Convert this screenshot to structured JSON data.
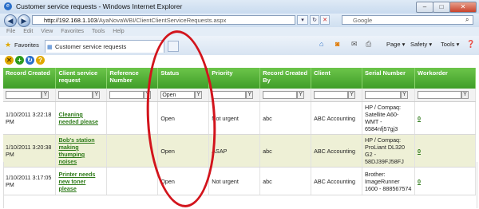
{
  "window": {
    "title": "Customer service requests - Windows Internet Explorer",
    "buttons": {
      "minimize": "–",
      "maximize": "□",
      "close": "✕"
    }
  },
  "address_bar": {
    "host": "http://192.168.1.103",
    "path": "/AyaNovaWBI/ClientClientServiceRequests.aspx",
    "search_placeholder": "Google"
  },
  "menu": [
    "File",
    "Edit",
    "View",
    "Favorites",
    "Tools",
    "Help"
  ],
  "favorites_bar": {
    "favorites_label": "Favorites",
    "tab_label": "Customer service requests",
    "commands": [
      "Page ▾",
      "Safety ▾",
      "Tools ▾"
    ]
  },
  "grid": {
    "columns": [
      "Record Created",
      "Client service request",
      "Reference Number",
      "Status",
      "Priority",
      "Record Created By",
      "Client",
      "Serial Number",
      "Workorder"
    ],
    "filter_values": [
      "",
      "",
      "",
      "Open",
      "",
      "",
      "",
      "",
      ""
    ],
    "rows": [
      {
        "created": "1/10/2011 3:22:18 PM",
        "request": "Cleaning needed please",
        "reference": "",
        "status": "Open",
        "priority": "Not urgent",
        "created_by": "abc",
        "client": "ABC Accounting",
        "serial": "HP / Compaq: Satellite A60-WMT - 6584nfj57gj3",
        "workorder": "0"
      },
      {
        "created": "1/10/2011 3:20:38 PM",
        "request": "Bob's station making thumping noises",
        "reference": "",
        "status": "Open",
        "priority": "ASAP",
        "created_by": "abc",
        "client": "ABC Accounting",
        "serial": "HP / Compaq: ProLiant DL320 G2 - 58DJ39FJ58FJ",
        "workorder": "0"
      },
      {
        "created": "1/10/2011 3:17:05 PM",
        "request": "Printer needs new toner please",
        "reference": "",
        "status": "Open",
        "priority": "Not urgent",
        "created_by": "abc",
        "client": "ABC Accounting",
        "serial": "Brother: ImageRunner 1600 - 888567574",
        "workorder": "0"
      }
    ]
  },
  "colors": {
    "header_green": "#4fae33",
    "link_green": "#2f7b1a",
    "alt_row": "#eef0d6",
    "annotation_red": "#d2141c"
  }
}
